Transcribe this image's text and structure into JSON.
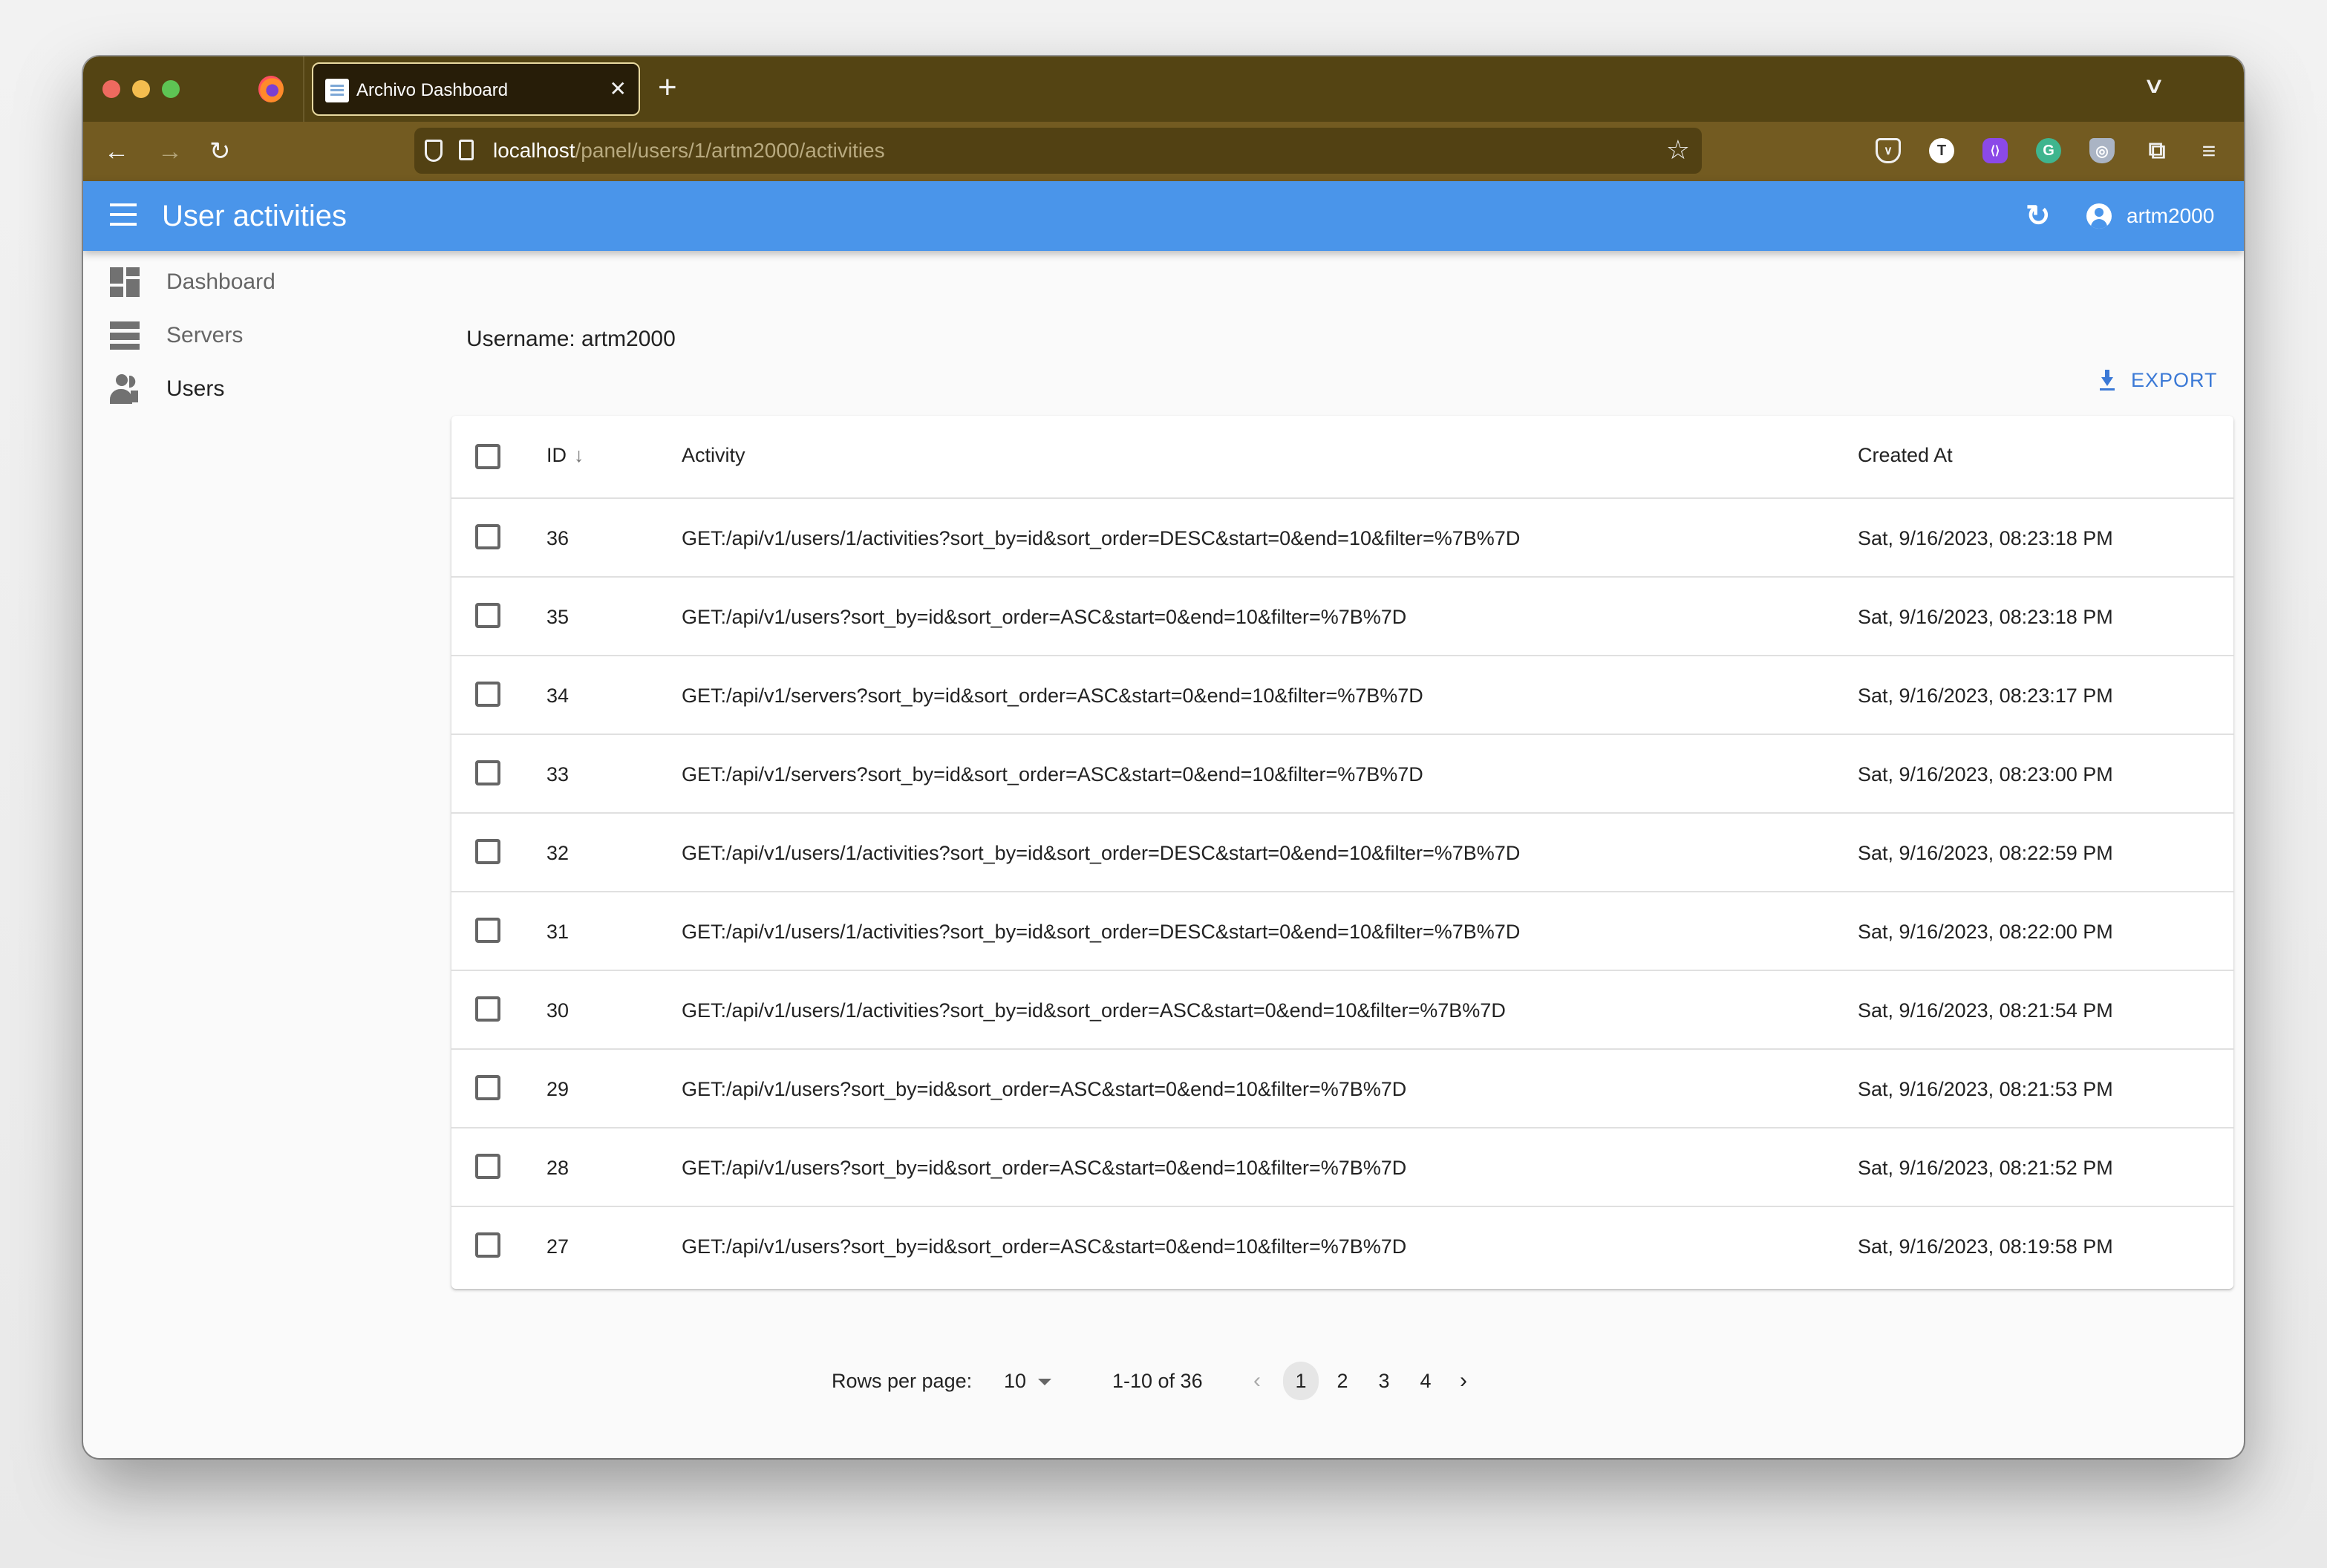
{
  "browser": {
    "tab_title": "Archivo Dashboard",
    "tab_close": "✕",
    "new_tab": "+",
    "tab_list": "∨",
    "url_host": "localhost",
    "url_path": "/panel/users/1/artm2000/activities",
    "nav": {
      "back": "←",
      "forward": "→",
      "reload": "↻",
      "bookmark": "☆"
    },
    "extensions": [
      {
        "name": "pocket-icon",
        "glyph": "∨"
      },
      {
        "name": "t-extension-icon",
        "glyph": "T"
      },
      {
        "name": "code-extension-icon",
        "glyph": "⟨⟩"
      },
      {
        "name": "grammarly-icon",
        "glyph": "G"
      },
      {
        "name": "shield-extension-icon",
        "glyph": "◎"
      },
      {
        "name": "extensions-puzzle-icon",
        "glyph": "⧉"
      },
      {
        "name": "menu-icon",
        "glyph": "≡"
      }
    ]
  },
  "appbar": {
    "title": "User activities",
    "refresh_glyph": "↻",
    "username": "artm2000",
    "accent_color": "#4a95ea"
  },
  "sidebar": {
    "items": [
      {
        "label": "Dashboard",
        "icon": "dashboard-icon",
        "active": false
      },
      {
        "label": "Servers",
        "icon": "servers-icon",
        "active": false
      },
      {
        "label": "Users",
        "icon": "users-icon",
        "active": true
      }
    ]
  },
  "main": {
    "username_line": "Username: artm2000",
    "export_label": "EXPORT",
    "table": {
      "columns": {
        "id": "ID",
        "id_sort": "↓",
        "activity": "Activity",
        "created_at": "Created At"
      },
      "rows": [
        {
          "id": "36",
          "activity": "GET:/api/v1/users/1/activities?sort_by=id&sort_order=DESC&start=0&end=10&filter=%7B%7D",
          "created_at": "Sat, 9/16/2023, 08:23:18 PM"
        },
        {
          "id": "35",
          "activity": "GET:/api/v1/users?sort_by=id&sort_order=ASC&start=0&end=10&filter=%7B%7D",
          "created_at": "Sat, 9/16/2023, 08:23:18 PM"
        },
        {
          "id": "34",
          "activity": "GET:/api/v1/servers?sort_by=id&sort_order=ASC&start=0&end=10&filter=%7B%7D",
          "created_at": "Sat, 9/16/2023, 08:23:17 PM"
        },
        {
          "id": "33",
          "activity": "GET:/api/v1/servers?sort_by=id&sort_order=ASC&start=0&end=10&filter=%7B%7D",
          "created_at": "Sat, 9/16/2023, 08:23:00 PM"
        },
        {
          "id": "32",
          "activity": "GET:/api/v1/users/1/activities?sort_by=id&sort_order=DESC&start=0&end=10&filter=%7B%7D",
          "created_at": "Sat, 9/16/2023, 08:22:59 PM"
        },
        {
          "id": "31",
          "activity": "GET:/api/v1/users/1/activities?sort_by=id&sort_order=DESC&start=0&end=10&filter=%7B%7D",
          "created_at": "Sat, 9/16/2023, 08:22:00 PM"
        },
        {
          "id": "30",
          "activity": "GET:/api/v1/users/1/activities?sort_by=id&sort_order=ASC&start=0&end=10&filter=%7B%7D",
          "created_at": "Sat, 9/16/2023, 08:21:54 PM"
        },
        {
          "id": "29",
          "activity": "GET:/api/v1/users?sort_by=id&sort_order=ASC&start=0&end=10&filter=%7B%7D",
          "created_at": "Sat, 9/16/2023, 08:21:53 PM"
        },
        {
          "id": "28",
          "activity": "GET:/api/v1/users?sort_by=id&sort_order=ASC&start=0&end=10&filter=%7B%7D",
          "created_at": "Sat, 9/16/2023, 08:21:52 PM"
        },
        {
          "id": "27",
          "activity": "GET:/api/v1/users?sort_by=id&sort_order=ASC&start=0&end=10&filter=%7B%7D",
          "created_at": "Sat, 9/16/2023, 08:19:58 PM"
        }
      ]
    },
    "pagination": {
      "rows_per_page_label": "Rows per page:",
      "rows_per_page_value": "10",
      "range": "1-10 of 36",
      "prev": "‹",
      "next": "›",
      "pages": [
        "1",
        "2",
        "3",
        "4"
      ],
      "current_page": "1"
    }
  }
}
